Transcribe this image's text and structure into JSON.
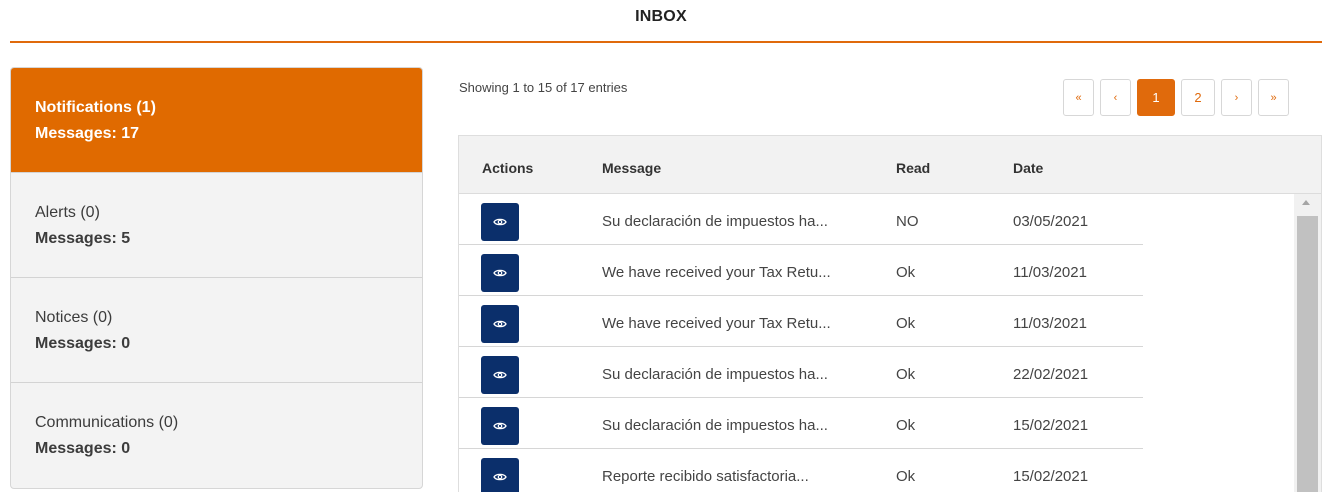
{
  "page": {
    "title": "INBOX"
  },
  "sidebar": {
    "items": [
      {
        "name": "Notifications (1)",
        "count": "Messages: 17",
        "active": true
      },
      {
        "name": "Alerts (0)",
        "count": "Messages: 5",
        "active": false
      },
      {
        "name": "Notices (0)",
        "count": "Messages: 0",
        "active": false
      },
      {
        "name": "Communications (0)",
        "count": "Messages: 0",
        "active": false
      }
    ]
  },
  "table_info": {
    "text": "Showing 1 to 15 of 17 entries"
  },
  "pagination": {
    "first": "«",
    "prev": "‹",
    "pages": [
      "1",
      "2"
    ],
    "current": "1",
    "next": "›",
    "last": "»"
  },
  "table": {
    "headers": {
      "actions": "Actions",
      "message": "Message",
      "read": "Read",
      "date": "Date"
    },
    "rows": [
      {
        "message": "Su declaración de impuestos ha...",
        "read": "NO",
        "date": "03/05/2021"
      },
      {
        "message": "We have received your Tax Retu...",
        "read": "Ok",
        "date": "11/03/2021"
      },
      {
        "message": "We have received your Tax Retu...",
        "read": "Ok",
        "date": "11/03/2021"
      },
      {
        "message": "Su declaración de impuestos ha...",
        "read": "Ok",
        "date": "22/02/2021"
      },
      {
        "message": "Su declaración de impuestos ha...",
        "read": "Ok",
        "date": "15/02/2021"
      },
      {
        "message": "Reporte recibido satisfactoria...",
        "read": "Ok",
        "date": "15/02/2021"
      }
    ],
    "row_action_icon": "eye-icon"
  },
  "colors": {
    "accent": "#e06a0c",
    "action_button": "#0b2f6b",
    "sidebar_bg": "#f3f3f3"
  }
}
